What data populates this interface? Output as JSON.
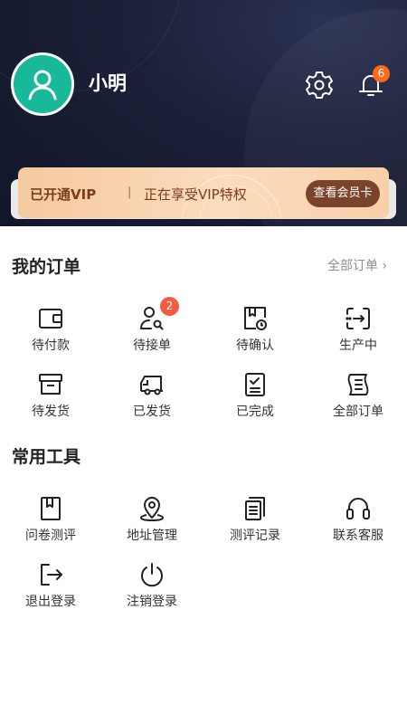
{
  "profile": {
    "name": "小明",
    "notification_count": "6"
  },
  "vip": {
    "status": "已开通VIP",
    "separator": "|",
    "desc": "正在享受VIP特权",
    "button": "查看会员卡"
  },
  "orders": {
    "title": "我的订单",
    "all_link": "全部订单",
    "items": [
      {
        "label": "待付款",
        "icon": "wallet-icon"
      },
      {
        "label": "待接单",
        "icon": "user-search-icon",
        "badge": "2"
      },
      {
        "label": "待确认",
        "icon": "clock-document-icon"
      },
      {
        "label": "生产中",
        "icon": "transfer-icon"
      },
      {
        "label": "待发货",
        "icon": "box-icon"
      },
      {
        "label": "已发货",
        "icon": "truck-icon"
      },
      {
        "label": "已完成",
        "icon": "checklist-icon"
      },
      {
        "label": "全部订单",
        "icon": "scroll-icon"
      }
    ]
  },
  "tools": {
    "title": "常用工具",
    "items": [
      {
        "label": "问卷测评",
        "icon": "bookmark-book-icon"
      },
      {
        "label": "地址管理",
        "icon": "location-pin-icon"
      },
      {
        "label": "测评记录",
        "icon": "records-icon"
      },
      {
        "label": "联系客服",
        "icon": "headset-icon"
      },
      {
        "label": "退出登录",
        "icon": "logout-icon"
      },
      {
        "label": "注销登录",
        "icon": "power-icon"
      }
    ]
  },
  "colors": {
    "avatar": "#18b89b",
    "badge_orange": "#ff6a1a",
    "badge_red": "#f25c45",
    "vip_button": "#7a432b"
  }
}
